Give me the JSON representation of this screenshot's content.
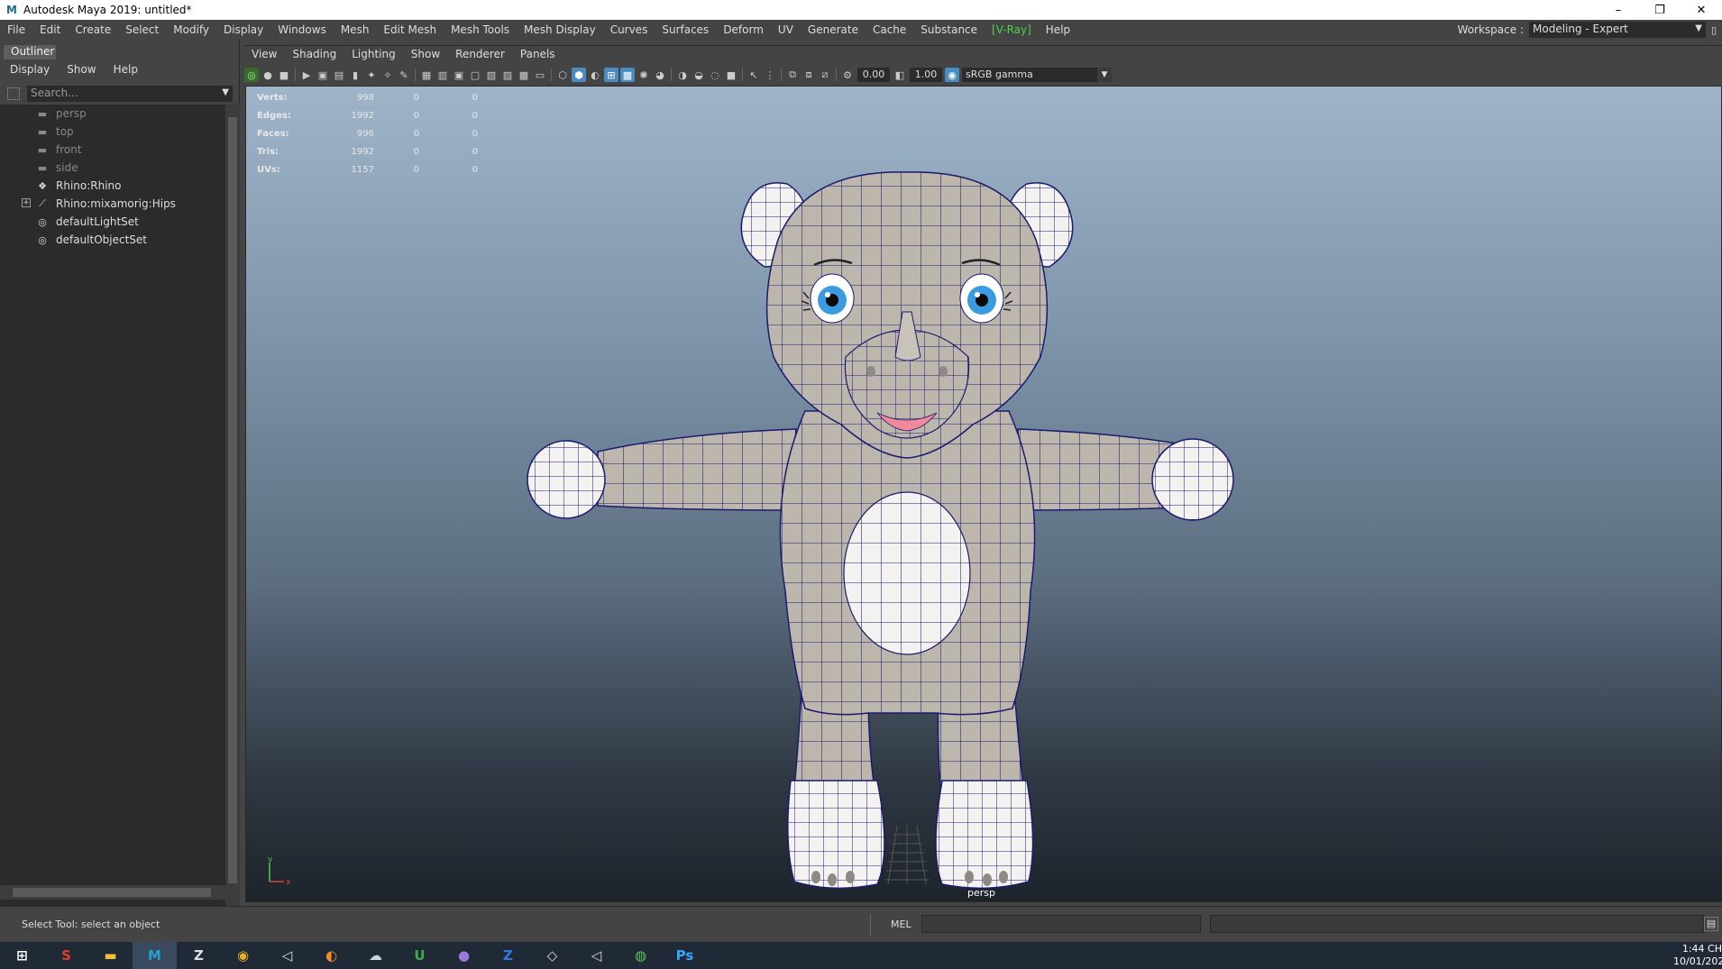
{
  "titlebar": {
    "app_icon": "maya-icon",
    "title": "Autodesk Maya 2019: untitled*",
    "minimize": "–",
    "restore": "❐",
    "close": "✕"
  },
  "menubar": {
    "items": [
      "File",
      "Edit",
      "Create",
      "Select",
      "Modify",
      "Display",
      "Windows",
      "Mesh",
      "Edit Mesh",
      "Mesh Tools",
      "Mesh Display",
      "Curves",
      "Surfaces",
      "Deform",
      "UV",
      "Generate",
      "Cache",
      "Substance",
      "[V-Ray]",
      "Help"
    ],
    "vray_color": "#4fd04f"
  },
  "workspace": {
    "label": "Workspace :",
    "value": "Modeling - Expert"
  },
  "outliner": {
    "tab": "Outliner",
    "menu": [
      "Display",
      "Show",
      "Help"
    ],
    "search_placeholder": "Search...",
    "items": [
      {
        "label": "persp",
        "icon": "camera-icon",
        "type": "camera"
      },
      {
        "label": "top",
        "icon": "camera-icon",
        "type": "camera"
      },
      {
        "label": "front",
        "icon": "camera-icon",
        "type": "camera"
      },
      {
        "label": "side",
        "icon": "camera-icon",
        "type": "camera"
      },
      {
        "label": "Rhino:Rhino",
        "icon": "mesh-icon",
        "type": "mesh"
      },
      {
        "label": "Rhino:mixamorig:Hips",
        "icon": "joint-icon",
        "type": "joint",
        "expandable": true
      },
      {
        "label": "defaultLightSet",
        "icon": "set-icon",
        "type": "set"
      },
      {
        "label": "defaultObjectSet",
        "icon": "set-icon",
        "type": "set"
      }
    ]
  },
  "viewport": {
    "menu": [
      "View",
      "Shading",
      "Lighting",
      "Show",
      "Renderer",
      "Panels"
    ],
    "exposure": "0.00",
    "gamma": "1.00",
    "color_space": "sRGB gamma",
    "camera_label": "persp",
    "hud": [
      {
        "label": "Verts:",
        "v1": "998",
        "v2": "0",
        "v3": "0"
      },
      {
        "label": "Edges:",
        "v1": "1992",
        "v2": "0",
        "v3": "0"
      },
      {
        "label": "Faces:",
        "v1": "996",
        "v2": "0",
        "v3": "0"
      },
      {
        "label": "Tris:",
        "v1": "1992",
        "v2": "0",
        "v3": "0"
      },
      {
        "label": "UVs:",
        "v1": "1157",
        "v2": "0",
        "v3": "0"
      }
    ],
    "axis_y": "y",
    "axis_x": "x",
    "colors": {
      "wire": "#1a1a6e",
      "body": "#bdb6ad",
      "white": "#f4f2f0",
      "eye": "#3a9be0",
      "mouth": "#f08a9a"
    }
  },
  "statusbar": {
    "message": "Select Tool: select an object",
    "mel_label": "MEL"
  },
  "taskbar": {
    "items": [
      {
        "name": "windows-start-icon",
        "glyph": "⊞",
        "color": "#ffffff"
      },
      {
        "name": "app-red-icon",
        "glyph": "S",
        "color": "#e0402a"
      },
      {
        "name": "file-explorer-icon",
        "glyph": "▬",
        "color": "#f2c23a"
      },
      {
        "name": "maya-taskbar-icon",
        "glyph": "M",
        "color": "#25a0c8",
        "active": true
      },
      {
        "name": "zbrush-icon",
        "glyph": "Z",
        "color": "#dddddd"
      },
      {
        "name": "chrome-icon",
        "glyph": "◉",
        "color": "#e8b024"
      },
      {
        "name": "unity-hub-icon",
        "glyph": "◁",
        "color": "#dddddd"
      },
      {
        "name": "blender-icon",
        "glyph": "◐",
        "color": "#f08a24"
      },
      {
        "name": "app-cloud-icon",
        "glyph": "☁",
        "color": "#c8d8e8"
      },
      {
        "name": "upwork-icon",
        "glyph": "U",
        "color": "#3ab04a"
      },
      {
        "name": "github-icon",
        "glyph": "●",
        "color": "#9a7ad8"
      },
      {
        "name": "zalo-icon",
        "glyph": "Z",
        "color": "#2a7ae0"
      },
      {
        "name": "unity-icon",
        "glyph": "◇",
        "color": "#dddddd"
      },
      {
        "name": "unity-editor-icon",
        "glyph": "◁",
        "color": "#dddddd"
      },
      {
        "name": "app-green-icon",
        "glyph": "◍",
        "color": "#5ac85a"
      },
      {
        "name": "photoshop-icon",
        "glyph": "Ps",
        "color": "#31a8ff"
      }
    ],
    "time": "1:44 CH",
    "date": "10/01/202"
  }
}
